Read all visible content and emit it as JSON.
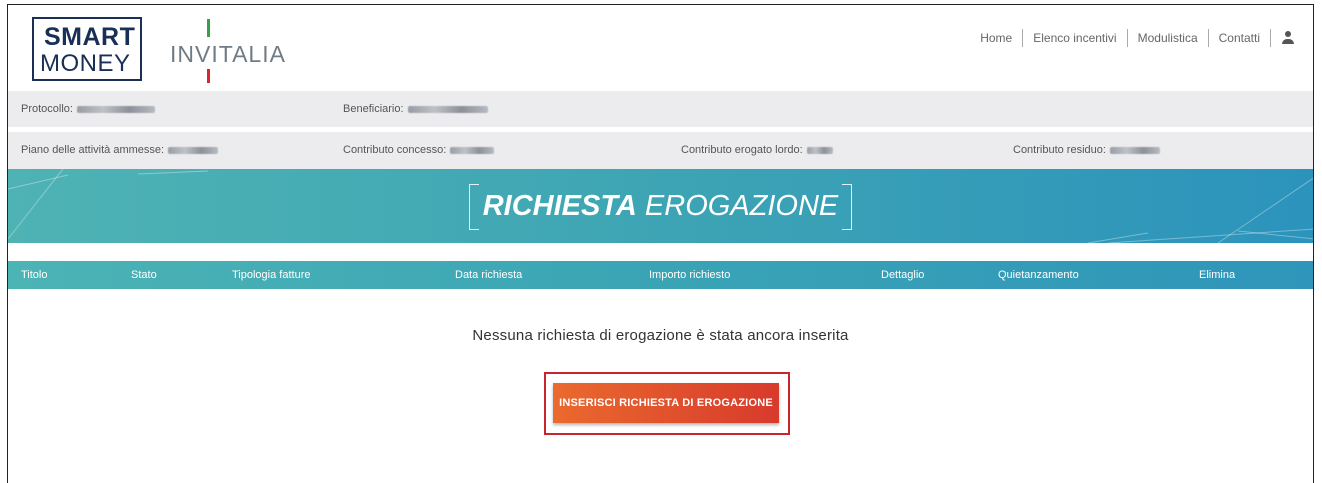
{
  "header": {
    "logo_line1": "SMART",
    "logo_line2": "MONEY",
    "brand": "INVITALIA",
    "nav": [
      "Home",
      "Elenco incentivi",
      "Modulistica",
      "Contatti"
    ]
  },
  "info": {
    "protocollo_label": "Protocollo:",
    "beneficiario_label": "Beneficiario:",
    "piano_label": "Piano delle attività ammesse:",
    "contributo_concesso_label": "Contributo concesso:",
    "contributo_erogato_label": "Contributo erogato lordo:",
    "contributo_residuo_label": "Contributo residuo:"
  },
  "banner": {
    "title_bold": "RICHIESTA",
    "title_rest": "EROGAZIONE"
  },
  "table": {
    "columns": [
      "Titolo",
      "Stato",
      "Tipologia fatture",
      "Data richiesta",
      "Importo richiesto",
      "Dettaglio",
      "Quietanzamento",
      "Elimina"
    ]
  },
  "empty_message": "Nessuna richiesta di erogazione è stata ancora inserita",
  "cta_label": "INSERISCI RICHIESTA DI EROGAZIONE",
  "colors": {
    "brand_navy": "#1a2f55",
    "teal": "#3fa6b4",
    "cta_orange": "#ea6a2e",
    "cta_red": "#d83a2c",
    "highlight_red": "#c8252f"
  },
  "icons": [
    "user-icon"
  ]
}
